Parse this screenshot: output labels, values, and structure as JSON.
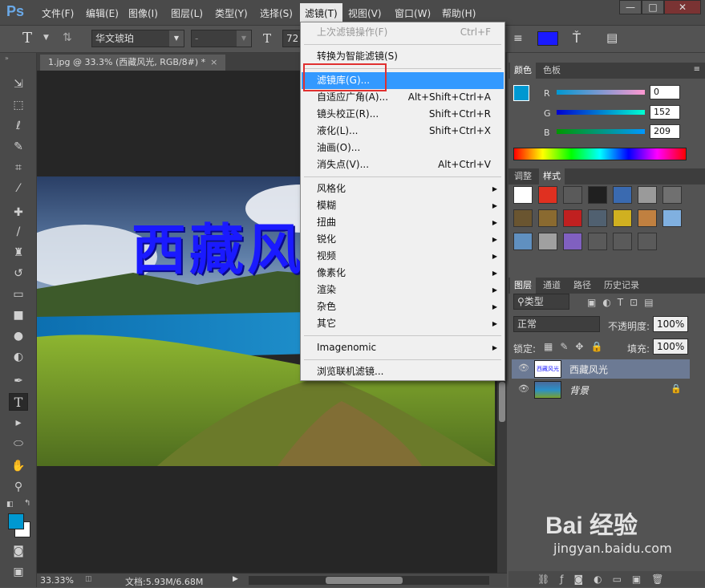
{
  "app": {
    "logo": "Ps"
  },
  "menu": [
    "文件(F)",
    "编辑(E)",
    "图像(I)",
    "图层(L)",
    "类型(Y)",
    "选择(S)",
    "滤镜(T)",
    "视图(V)",
    "窗口(W)",
    "帮助(H)"
  ],
  "window_controls": [
    "—",
    "□",
    "✕"
  ],
  "options": {
    "tool_glyph": "T",
    "font_family": "华文琥珀",
    "font_style": "-",
    "font_size": "72",
    "text_color": "#1a1aff"
  },
  "document": {
    "tab": "1.jpg @ 33.3% (西藏风光, RGB/8#) *",
    "overlay_text": "西藏风光",
    "text_color": "#1a1aff"
  },
  "status": {
    "zoom": "33.33%",
    "doc_info": "文档:5.93M/6.68M"
  },
  "filter_menu": {
    "group1": [
      {
        "label": "上次滤镜操作(F)",
        "shortcut": "Ctrl+F",
        "disabled": true
      }
    ],
    "group2": [
      {
        "label": "转换为智能滤镜(S)",
        "shortcut": ""
      }
    ],
    "group3": [
      {
        "label": "滤镜库(G)...",
        "shortcut": "",
        "highlighted": true
      },
      {
        "label": "自适应广角(A)...",
        "shortcut": "Alt+Shift+Ctrl+A"
      },
      {
        "label": "镜头校正(R)...",
        "shortcut": "Shift+Ctrl+R"
      },
      {
        "label": "液化(L)...",
        "shortcut": "Shift+Ctrl+X"
      },
      {
        "label": "油画(O)...",
        "shortcut": ""
      },
      {
        "label": "消失点(V)...",
        "shortcut": "Alt+Ctrl+V"
      }
    ],
    "group4": [
      "风格化",
      "模糊",
      "扭曲",
      "锐化",
      "视频",
      "像素化",
      "渲染",
      "杂色",
      "其它"
    ],
    "group5": [
      "Imagenomic"
    ],
    "group6": [
      "浏览联机滤镜..."
    ]
  },
  "color_panel": {
    "tabs": [
      "颜色",
      "色板"
    ],
    "channels": [
      {
        "label": "R",
        "value": "0"
      },
      {
        "label": "G",
        "value": "152"
      },
      {
        "label": "B",
        "value": "209"
      }
    ],
    "foreground": "#0098d1"
  },
  "styles_panel": {
    "tabs": [
      "调整",
      "样式"
    ]
  },
  "layers_panel": {
    "tabs": [
      "图层",
      "通道",
      "路径",
      "历史记录"
    ],
    "filter_kind": "类型",
    "blend_mode": "正常",
    "opacity_label": "不透明度:",
    "opacity": "100%",
    "lock_label": "锁定:",
    "fill_label": "填充:",
    "fill": "100%",
    "layers": [
      {
        "name": "西藏风光",
        "thumb_text": "西藏风光",
        "selected": true
      },
      {
        "name": "背景",
        "locked": true
      }
    ]
  },
  "watermark": {
    "brand": "Bai 经验",
    "url": "jingyan.baidu.com"
  }
}
